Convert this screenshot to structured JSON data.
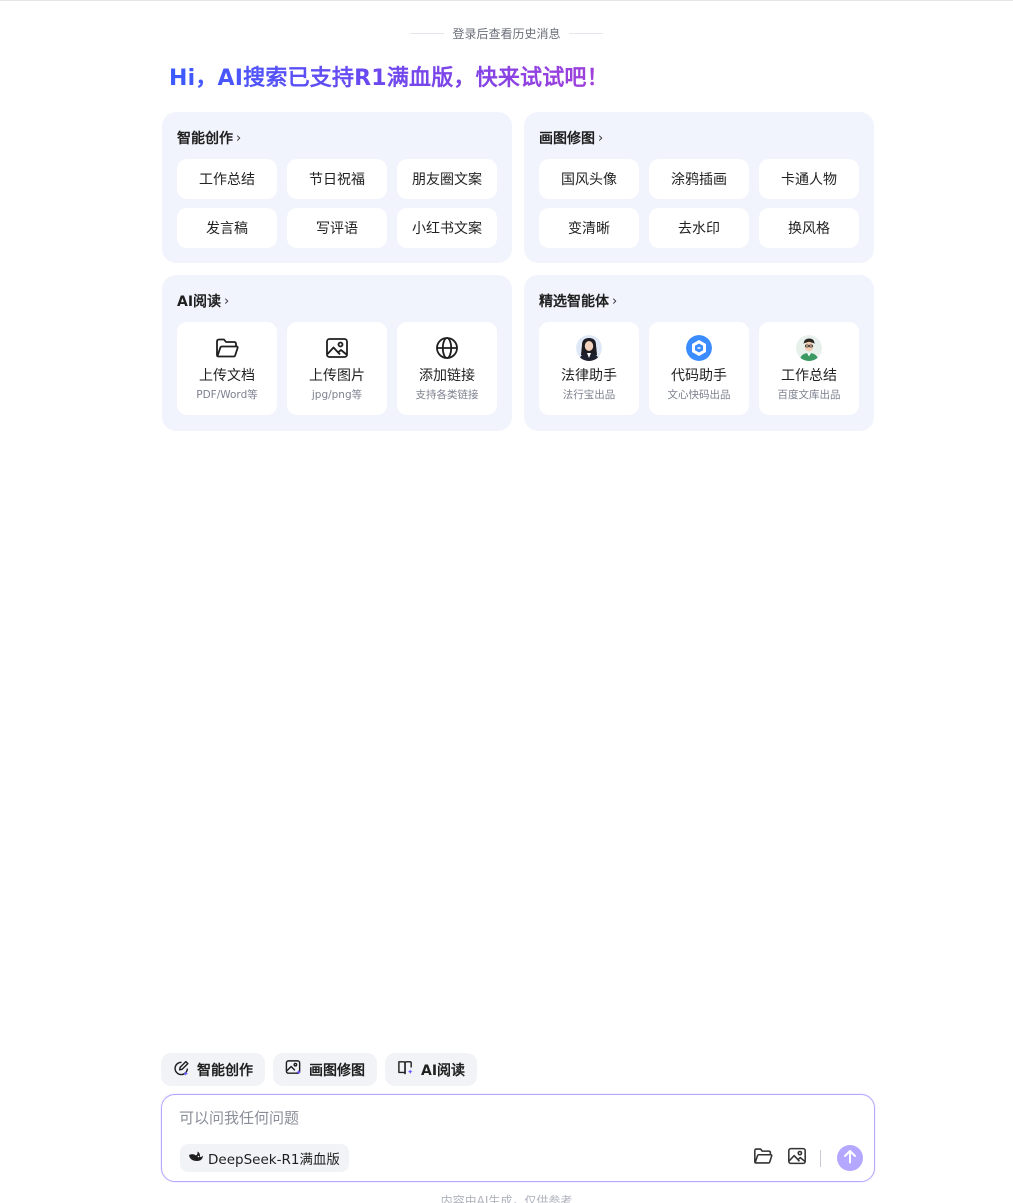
{
  "history_hint": "登录后查看历史消息",
  "headline": "Hi，AI搜索已支持R1满血版，快来试试吧！",
  "cards": {
    "creation": {
      "title": "智能创作",
      "chips": [
        "工作总结",
        "节日祝福",
        "朋友圈文案",
        "发言稿",
        "写评语",
        "小红书文案"
      ]
    },
    "drawing": {
      "title": "画图修图",
      "chips": [
        "国风头像",
        "涂鸦插画",
        "卡通人物",
        "变清晰",
        "去水印",
        "换风格"
      ]
    },
    "reading": {
      "title": "AI阅读",
      "tiles": [
        {
          "label": "上传文档",
          "sub": "PDF/Word等",
          "icon": "folder-icon"
        },
        {
          "label": "上传图片",
          "sub": "jpg/png等",
          "icon": "image-icon"
        },
        {
          "label": "添加链接",
          "sub": "支持各类链接",
          "icon": "globe-icon"
        }
      ]
    },
    "agents": {
      "title": "精选智能体",
      "tiles": [
        {
          "label": "法律助手",
          "sub": "法行宝出品",
          "icon": "lawyer-avatar"
        },
        {
          "label": "代码助手",
          "sub": "文心快码出品",
          "icon": "code-logo"
        },
        {
          "label": "工作总结",
          "sub": "百度文库出品",
          "icon": "worker-avatar"
        }
      ]
    }
  },
  "bottom_tabs": [
    {
      "label": "智能创作",
      "icon": "pen-sparkle-icon"
    },
    {
      "label": "画图修图",
      "icon": "image-sparkle-icon"
    },
    {
      "label": "AI阅读",
      "icon": "book-sparkle-icon"
    }
  ],
  "input": {
    "placeholder": "可以问我任何问题",
    "value": "",
    "model_label": "DeepSeek-R1满血版",
    "model_icon": "whale-icon"
  },
  "footnote": "内容由AI生成，仅供参考",
  "colors": {
    "card_bg": "#f2f4fd",
    "accent": "#b3a7ff",
    "gradient_start": "#3b5bff",
    "gradient_end": "#a23fd9"
  }
}
